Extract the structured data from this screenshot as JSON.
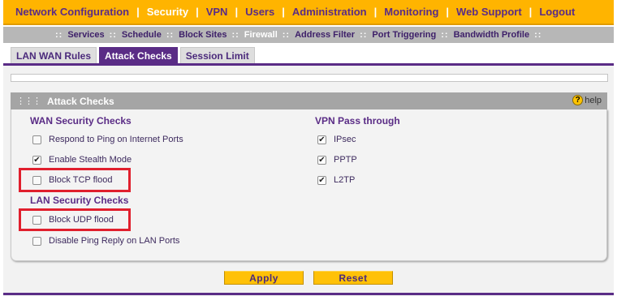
{
  "topnav": {
    "items": [
      "Network Configuration",
      "Security",
      "VPN",
      "Users",
      "Administration",
      "Monitoring",
      "Web Support",
      "Logout"
    ],
    "active": "Security"
  },
  "subnav": {
    "items": [
      "Services",
      "Schedule",
      "Block Sites",
      "Firewall",
      "Address Filter",
      "Port Triggering",
      "Bandwidth Profile"
    ],
    "active": "Firewall"
  },
  "tabs": {
    "items": [
      "LAN WAN Rules",
      "Attack Checks",
      "Session Limit"
    ],
    "active": "Attack Checks"
  },
  "section": {
    "title": "Attack Checks",
    "help_label": "help",
    "help_icon": "question-icon"
  },
  "wan": {
    "heading": "WAN Security Checks",
    "respond_ping": {
      "label": "Respond to Ping on Internet Ports",
      "checked": false
    },
    "stealth": {
      "label": "Enable Stealth Mode",
      "checked": true
    },
    "tcp_flood": {
      "label": "Block TCP flood",
      "checked": false
    }
  },
  "lan": {
    "heading": "LAN Security Checks",
    "udp_flood": {
      "label": "Block UDP flood",
      "checked": false
    },
    "disable_ping": {
      "label": "Disable Ping Reply on LAN Ports",
      "checked": false
    }
  },
  "vpn": {
    "heading": "VPN Pass through",
    "ipsec": {
      "label": "IPsec",
      "checked": true
    },
    "pptp": {
      "label": "PPTP",
      "checked": true
    },
    "l2tp": {
      "label": "L2TP",
      "checked": true
    }
  },
  "buttons": {
    "apply": "Apply",
    "reset": "Reset"
  },
  "colors": {
    "nav_bg": "#ffb400",
    "brand_purple": "#5a2c86",
    "highlight_red": "#e01f2d",
    "button_yellow": "#ffc107"
  }
}
